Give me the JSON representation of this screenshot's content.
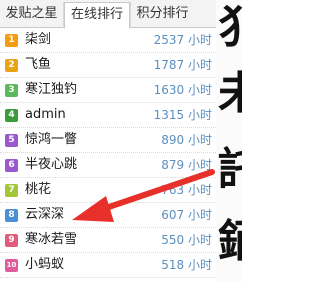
{
  "calligraphy": [
    "犭",
    "未",
    "託",
    "銆"
  ],
  "tabs": [
    {
      "label": "发贴之星"
    },
    {
      "label": "在线排行"
    },
    {
      "label": "积分排行"
    }
  ],
  "active_tab": "在线排行",
  "ranking": [
    {
      "rank": "1",
      "name": "柒剑",
      "time": "2537 小时",
      "color": "#f39c12"
    },
    {
      "rank": "2",
      "name": "飞鱼",
      "time": "1787 小时",
      "color": "#e8a317"
    },
    {
      "rank": "3",
      "name": "寒江独钓",
      "time": "1630 小时",
      "color": "#5cb85c"
    },
    {
      "rank": "4",
      "name": "admin",
      "time": "1315 小时",
      "color": "#3c9c3c"
    },
    {
      "rank": "5",
      "name": "惊鸿一瞥",
      "time": "890 小时",
      "color": "#9b59d0"
    },
    {
      "rank": "6",
      "name": "半夜心跳",
      "time": "879 小时",
      "color": "#9b59d0"
    },
    {
      "rank": "7",
      "name": "桃花",
      "time": "763 小时",
      "color": "#a4c639"
    },
    {
      "rank": "8",
      "name": "云深深",
      "time": "607 小时",
      "color": "#4a90d9"
    },
    {
      "rank": "9",
      "name": "寒冰若雪",
      "time": "550 小时",
      "color": "#e05c7b"
    },
    {
      "rank": "10",
      "name": "小蚂蚁",
      "time": "518 小时",
      "color": "#e05c9b"
    }
  ],
  "annotation": {
    "arrow_color": "#e8302a"
  }
}
